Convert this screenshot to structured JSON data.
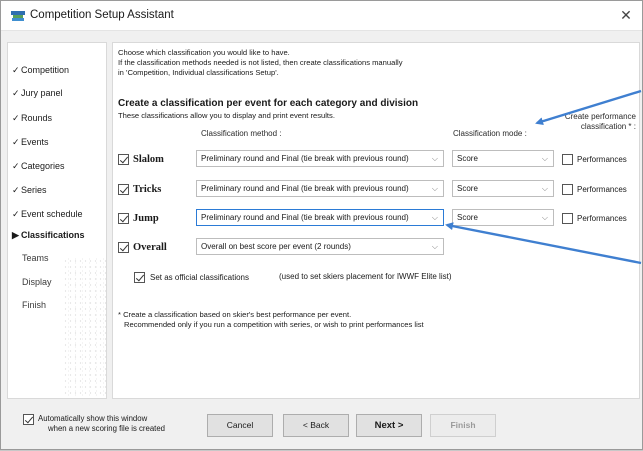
{
  "window": {
    "title": "Competition Setup Assistant",
    "close_glyph": "✕"
  },
  "sidebar": {
    "items": [
      {
        "label": "Competition",
        "mark": "✓"
      },
      {
        "label": "Jury panel",
        "mark": "✓"
      },
      {
        "label": "Rounds",
        "mark": "✓"
      },
      {
        "label": "Events",
        "mark": "✓"
      },
      {
        "label": "Categories",
        "mark": "✓"
      },
      {
        "label": "Series",
        "mark": "✓"
      },
      {
        "label": "Event schedule",
        "mark": "✓"
      },
      {
        "label": "Classifications",
        "mark": "▶"
      },
      {
        "label": "Teams",
        "mark": ""
      },
      {
        "label": "Display",
        "mark": ""
      },
      {
        "label": "Finish",
        "mark": ""
      }
    ]
  },
  "content": {
    "info_line1": "Choose which classification you would like to have.",
    "info_line2": "If the classification methods needed is not listed, then create classifications manually",
    "info_line3": "in 'Competition, Individual classifications Setup'.",
    "section_title": "Create a classification per event for each category and division",
    "section_desc": "These classifications allow you to display and print event results.",
    "col_method": "Classification method :",
    "col_mode": "Classification mode :",
    "col_perf_line1": "Create performance",
    "col_perf_line2": "classification * :",
    "rows": [
      {
        "label": "Slalom",
        "checked": true,
        "method": "Preliminary round and Final (tie break with previous round)",
        "mode": "Score",
        "performances_label": "Performances",
        "performances_checked": false
      },
      {
        "label": "Tricks",
        "checked": true,
        "method": "Preliminary round and Final (tie break with previous round)",
        "mode": "Score",
        "performances_label": "Performances",
        "performances_checked": false
      },
      {
        "label": "Jump",
        "checked": true,
        "method": "Preliminary round and Final (tie break with previous round)",
        "mode": "Score",
        "performances_label": "Performances",
        "performances_checked": false
      },
      {
        "label": "Overall",
        "checked": true,
        "method": "Overall on best score per event (2 rounds)"
      }
    ],
    "official_label": "Set as official classifications",
    "official_checked": true,
    "official_note": "(used to set skiers placement for IWWF Elite list)",
    "footnote_line1": "* Create a classification based on skier's best performance per event.",
    "footnote_line2": "Recommended only if you run a competition with series, or wish to print performances list"
  },
  "footer": {
    "auto_show_line1": "Automatically show this window",
    "auto_show_line2": "when a new scoring file is created",
    "auto_show_checked": true,
    "cancel_label": "Cancel",
    "back_label": "< Back",
    "next_label": "Next >",
    "finish_label": "Finish"
  },
  "colors": {
    "annotation_arrow": "#3f7fd0",
    "focus_border": "#2b7bd6"
  },
  "icons": {
    "app": "water-ski-app-icon",
    "chevron": "chevron-down-icon"
  }
}
